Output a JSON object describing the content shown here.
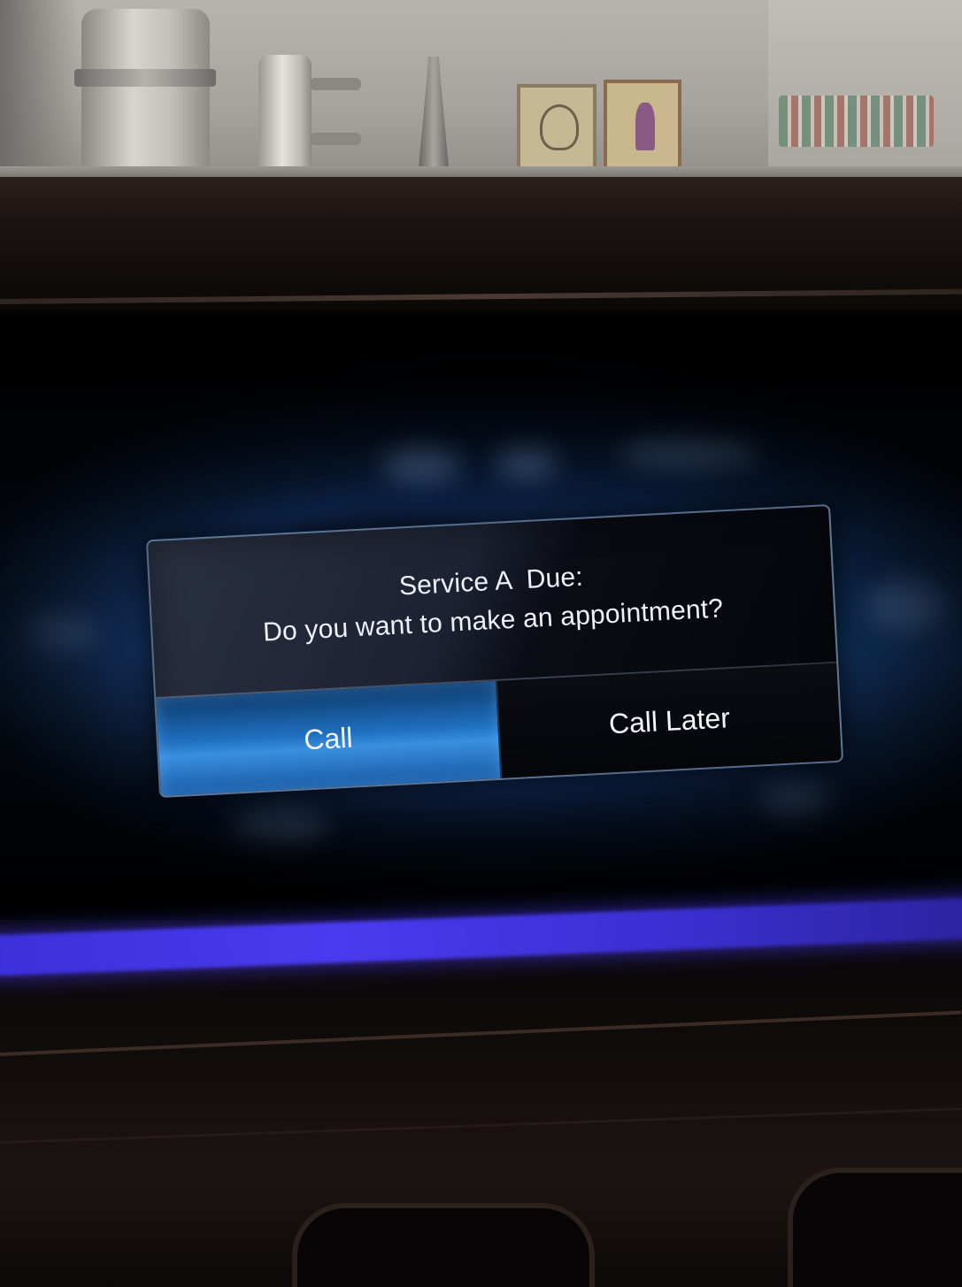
{
  "dialog": {
    "title": "Service A  Due:",
    "message": "Do you want to make an appointment?",
    "buttons": {
      "call": "Call",
      "call_later": "Call Later"
    },
    "selected_button": "call"
  },
  "colors": {
    "selected_button": "#1f6fc0",
    "ambient_light": "#4a3bf0",
    "dialog_text": "#eef1f6"
  }
}
